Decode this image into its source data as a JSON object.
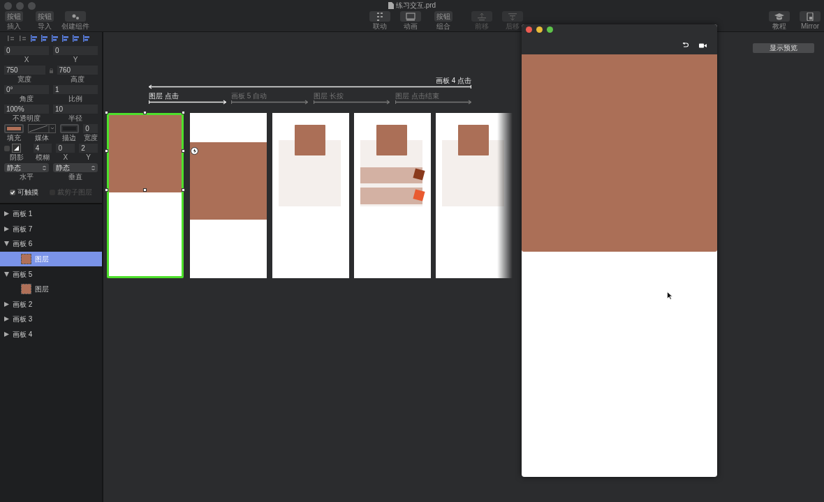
{
  "window": {
    "title": "练习交互.prd"
  },
  "toolbar_left": [
    {
      "kind": "text",
      "button_text": "按钮",
      "label": "插入",
      "disabled": false
    },
    {
      "kind": "text",
      "button_text": "按钮",
      "label": "导入",
      "disabled": false
    },
    {
      "kind": "gear",
      "label": "创建组件",
      "disabled": false
    }
  ],
  "toolbar_center": [
    {
      "kind": "link",
      "label": "联动",
      "disabled": false
    },
    {
      "kind": "screen",
      "label": "动画",
      "disabled": false
    },
    {
      "kind": "text",
      "button_text": "按钮",
      "label": "组合",
      "disabled": false
    },
    {
      "kind": "forward",
      "label": "前移",
      "disabled": true
    },
    {
      "kind": "backward",
      "label": "后移",
      "disabled": true
    }
  ],
  "toolbar_right": [
    {
      "kind": "cap",
      "label": "教程"
    },
    {
      "kind": "phone",
      "label": "Mirror"
    }
  ],
  "properties": [
    [
      {
        "kind": "input",
        "value": "0",
        "label": "X"
      },
      {
        "kind": "input",
        "value": "0",
        "label": "Y"
      }
    ],
    [
      {
        "kind": "input",
        "value": "750",
        "label": "宽度"
      },
      {
        "kind": "lock"
      },
      {
        "kind": "input",
        "value": "760",
        "label": "高度"
      }
    ],
    [
      {
        "kind": "input",
        "value": "0°",
        "label": "角度"
      },
      {
        "kind": "input",
        "value": "1",
        "label": "比例"
      }
    ],
    [
      {
        "kind": "input",
        "value": "100%",
        "label": "不透明度"
      },
      {
        "kind": "input",
        "value": "10",
        "label": "半径"
      }
    ],
    [
      {
        "kind": "swatch",
        "color": "#b07058",
        "label": "填充"
      },
      {
        "kind": "media",
        "label": "媒体"
      },
      {
        "kind": "swatch",
        "color": "#1e1f21",
        "label": "描边"
      },
      {
        "kind": "small",
        "value": "0",
        "label": "宽度"
      }
    ],
    [
      {
        "kind": "shadow",
        "checked": false,
        "label": "阴影"
      },
      {
        "kind": "small",
        "value": "4",
        "label": "模糊"
      },
      {
        "kind": "small",
        "value": "0",
        "label": "X"
      },
      {
        "kind": "small",
        "value": "2",
        "label": "Y"
      }
    ],
    [
      {
        "kind": "select",
        "value": "静态",
        "label": "水平"
      },
      {
        "kind": "select",
        "value": "静态",
        "label": "垂直"
      }
    ]
  ],
  "options": [
    {
      "label": "可触摸",
      "checked": true,
      "disabled": false
    },
    {
      "label": "裁剪子图层",
      "checked": false,
      "disabled": true
    }
  ],
  "layers": [
    {
      "label": "画板 1",
      "expanded": false,
      "selected": false
    },
    {
      "label": "画板 7",
      "expanded": false,
      "selected": false
    },
    {
      "label": "画板 6",
      "expanded": true,
      "selected": false,
      "children": [
        {
          "label": "图层",
          "selected": true,
          "color": "#b07058"
        }
      ]
    },
    {
      "label": "画板 5",
      "expanded": true,
      "selected": false,
      "children": [
        {
          "label": "图层",
          "selected": false,
          "color": "#b07058"
        }
      ]
    },
    {
      "label": "画板 2",
      "expanded": false,
      "selected": false
    },
    {
      "label": "画板 3",
      "expanded": false,
      "selected": false
    },
    {
      "label": "画板 4",
      "expanded": false,
      "selected": false
    }
  ],
  "interactions": [
    {
      "label": "画板 4 点击",
      "kind": "back",
      "active": true
    },
    {
      "label": "图层 点击",
      "kind": "forward",
      "active": true
    },
    {
      "label": "画板 5 自动",
      "kind": "forward",
      "active": false
    },
    {
      "label": "图层 长按",
      "kind": "forward",
      "active": false
    },
    {
      "label": "图层 点击结束",
      "kind": "forward",
      "active": false
    }
  ],
  "artboards": [
    {
      "kind": "top-block",
      "selected": true
    },
    {
      "kind": "middle-block",
      "selected": false
    },
    {
      "kind": "card",
      "selected": false
    },
    {
      "kind": "card-list",
      "selected": false
    },
    {
      "kind": "card",
      "selected": false
    }
  ],
  "preview_button": "显示预览"
}
